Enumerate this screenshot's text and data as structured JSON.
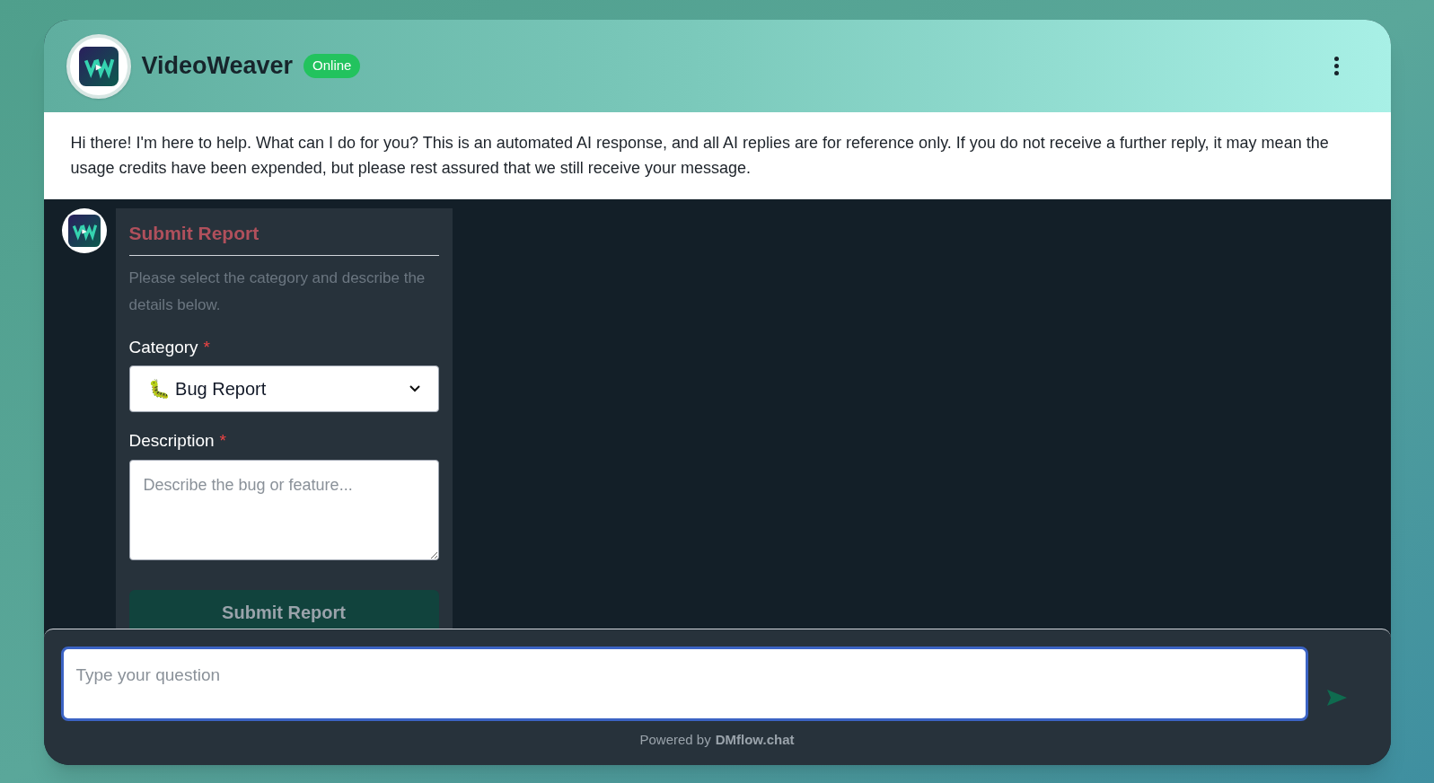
{
  "header": {
    "title": "VideoWeaver",
    "status": "Online"
  },
  "greeting": "Hi there! I'm here to help. What can I do for you? This is an automated AI response, and all AI replies are for reference only. If you do not receive a further reply, it may mean the usage credits have been expended, but please rest assured that we still receive your message.",
  "form": {
    "title": "Submit Report",
    "description": "Please select the category and describe the details below.",
    "fields": [
      {
        "kind": "select",
        "label": "Category",
        "required_mark": "*",
        "value": "🐛 Bug Report"
      },
      {
        "kind": "textarea",
        "label": "Description",
        "required_mark": "*",
        "placeholder": "Describe the bug or feature..."
      }
    ],
    "submit": "Submit Report"
  },
  "composer": {
    "placeholder": "Type your question"
  },
  "footer": {
    "prefix": "Powered by",
    "brand": "DMflow.chat"
  }
}
